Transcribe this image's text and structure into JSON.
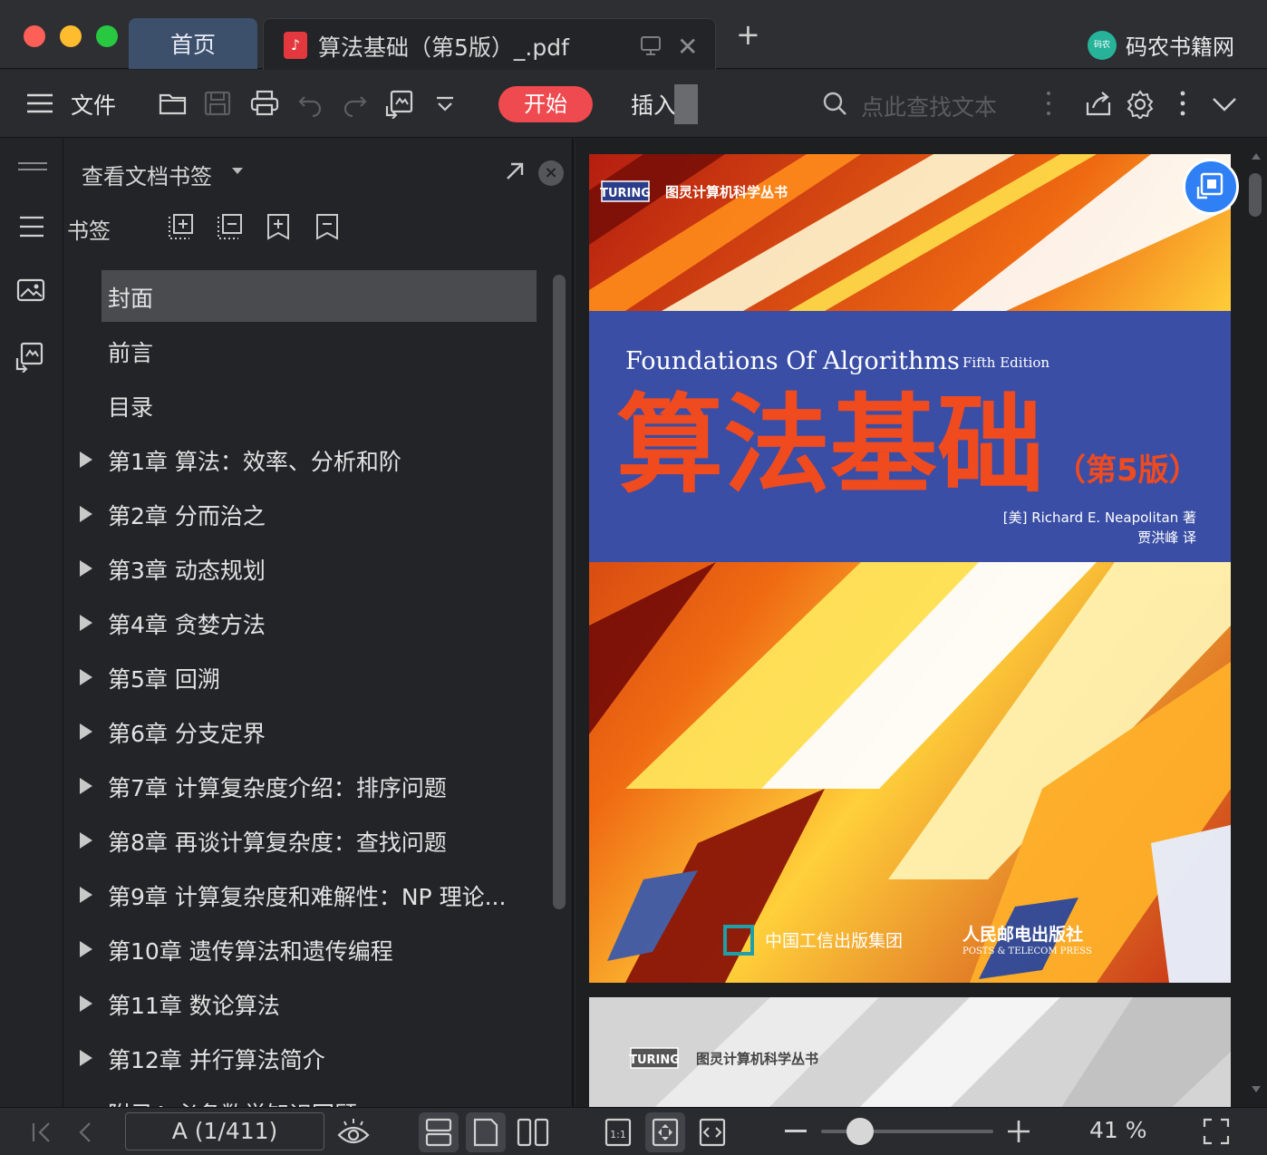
{
  "tabs": {
    "home_label": "首页",
    "doc_title": "算法基础（第5版）_.pdf",
    "brand": "码农书籍网",
    "brand_badge": "码农"
  },
  "toolbar": {
    "file_label": "文件",
    "start_label": "开始",
    "insert_label": "插入",
    "search_placeholder": "点此查找文本"
  },
  "panel": {
    "title": "查看文档书签",
    "bookmark_label": "书签",
    "items": [
      {
        "label": "封面",
        "expandable": false,
        "selected": true
      },
      {
        "label": "前言",
        "expandable": false
      },
      {
        "label": "目录",
        "expandable": false
      },
      {
        "label": "第1章 算法：效率、分析和阶",
        "expandable": true
      },
      {
        "label": "第2章 分而治之",
        "expandable": true
      },
      {
        "label": "第3章 动态规划",
        "expandable": true
      },
      {
        "label": "第4章 贪婪方法",
        "expandable": true
      },
      {
        "label": "第5章 回溯",
        "expandable": true
      },
      {
        "label": "第6章 分支定界",
        "expandable": true
      },
      {
        "label": "第7章 计算复杂度介绍：排序问题",
        "expandable": true
      },
      {
        "label": "第8章 再谈计算复杂度：查找问题",
        "expandable": true
      },
      {
        "label": "第9章 计算复杂度和难解性：NP 理论...",
        "expandable": true
      },
      {
        "label": "第10章 遗传算法和遗传编程",
        "expandable": true
      },
      {
        "label": "第11章 数论算法",
        "expandable": true
      },
      {
        "label": "第12章 并行算法简介",
        "expandable": true
      },
      {
        "label": "附录A 必备数学知识回顾",
        "expandable": false
      }
    ]
  },
  "cover": {
    "series": "图灵计算机科学丛书",
    "turing": "TURING",
    "en_title": "Foundations Of Algorithms",
    "edition_en": "Fifth Edition",
    "cn_title": "算法基础",
    "edition_cn": "（第5版）",
    "author": "[美] Richard E. Neapolitan 著",
    "translator": "贾洪峰 译",
    "publisher1": "中国工信出版集团",
    "publisher2": "人民邮电出版社",
    "publisher2_en": "POSTS & TELECOM PRESS"
  },
  "status": {
    "page_indicator": "A (1/411)",
    "zoom": "41 %",
    "zoom_value": 0.41
  },
  "colors": {
    "accent_red": "#ee4a4f",
    "tab_active": "#3c4f6b",
    "fab_blue": "#2f7ff5"
  }
}
